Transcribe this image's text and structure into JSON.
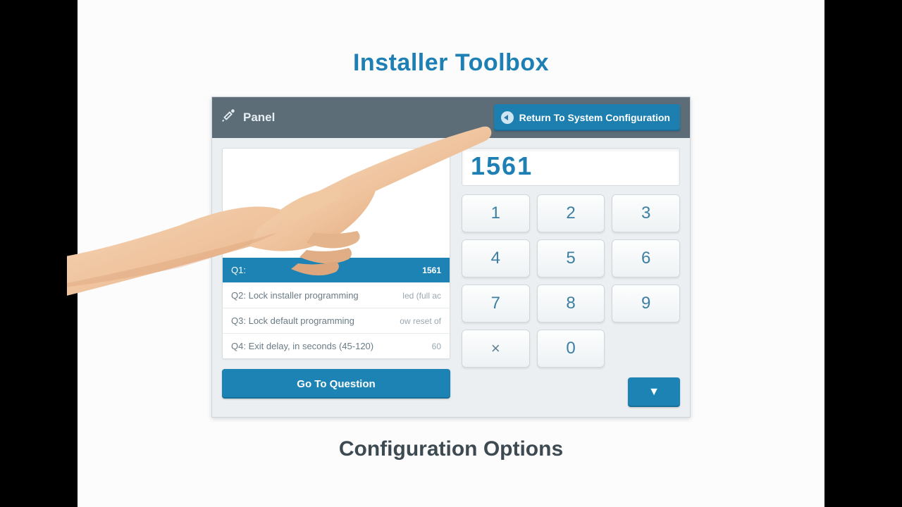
{
  "title": "Installer Toolbox",
  "subtitle": "Configuration Options",
  "header": {
    "panel_label": "Panel",
    "return_label": "Return To System Configuration"
  },
  "display_value": "1561",
  "rows": [
    {
      "q": "Q1:",
      "label": "",
      "value": "1561",
      "selected": true
    },
    {
      "q": "Q2:",
      "label": "Lock installer programming",
      "value": "led (full ac",
      "selected": false
    },
    {
      "q": "Q3:",
      "label": "Lock default programming",
      "value": "ow reset of",
      "selected": false
    },
    {
      "q": "Q4:",
      "label": "Exit delay, in seconds (45-120)",
      "value": "60",
      "selected": false
    }
  ],
  "go_label": "Go To Question",
  "keypad": {
    "k1": "1",
    "k2": "2",
    "k3": "3",
    "k4": "4",
    "k5": "5",
    "k6": "6",
    "k7": "7",
    "k8": "8",
    "k9": "9",
    "kx": "×",
    "k0": "0"
  },
  "down_icon": "▼"
}
